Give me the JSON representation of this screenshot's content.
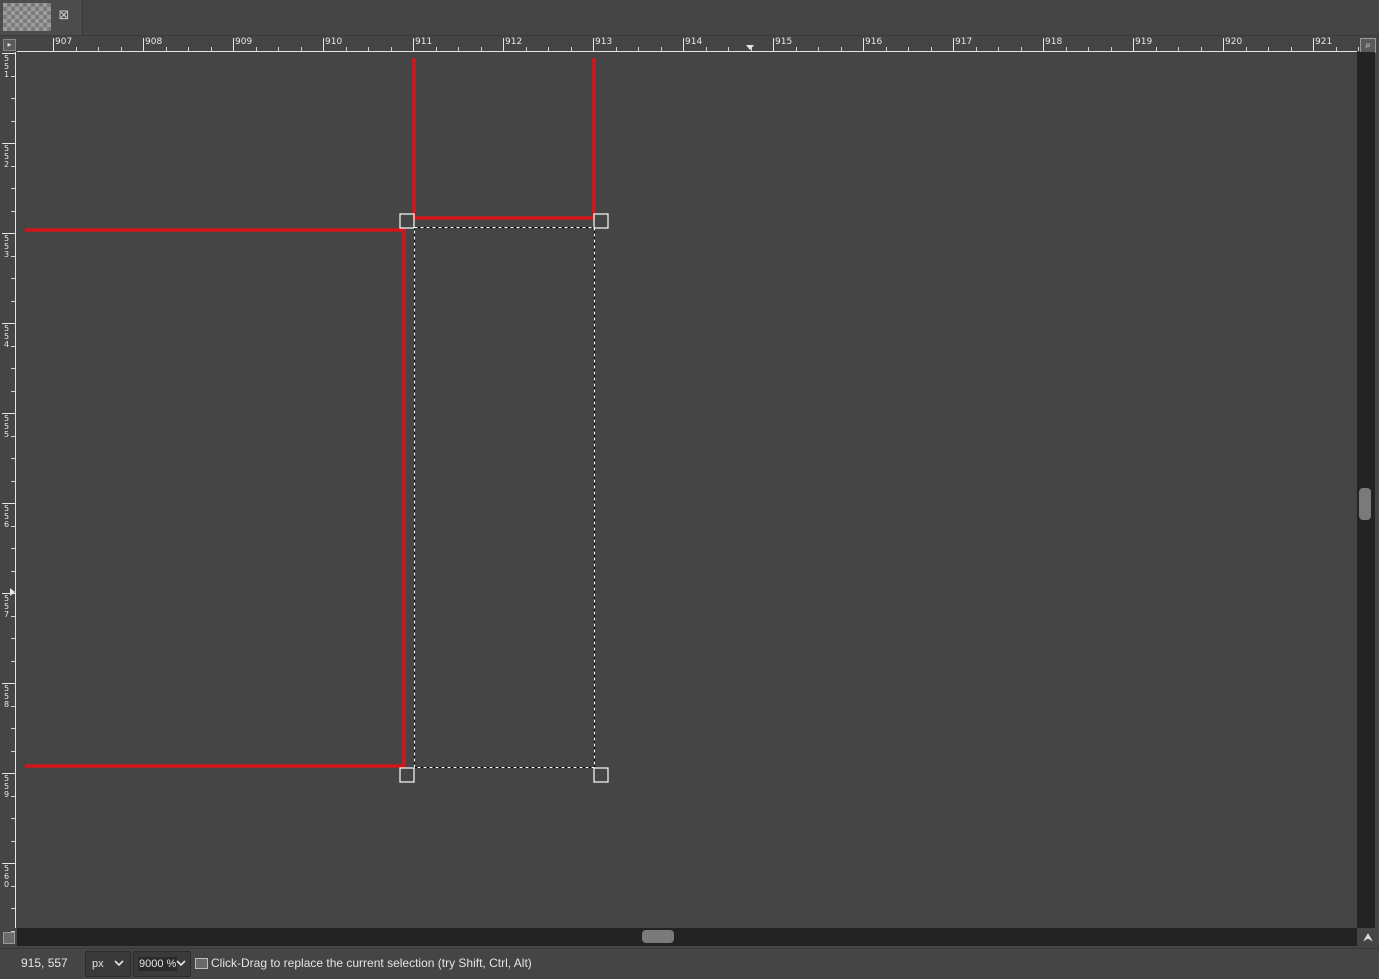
{
  "tab": {
    "close_glyph": "⊠",
    "thumbnail_icon": "checkerboard-thumbnail-icon",
    "close_icon": "close-tab-icon"
  },
  "rulers": {
    "horizontal_labels": [
      "907",
      "908",
      "909",
      "910",
      "911",
      "912",
      "913",
      "914",
      "915",
      "916",
      "917",
      "918",
      "919",
      "920",
      "921"
    ],
    "vertical_labels": [
      "551",
      "552",
      "553",
      "554",
      "555",
      "556",
      "557",
      "558",
      "559",
      "560"
    ]
  },
  "corner_icons": {
    "quickmask": "quick-mask-toggle-icon",
    "navigate": "navigate-magnifier-icon",
    "zoom_follow": "zoom-follow-arrow-icon"
  },
  "canvas": {
    "path_color": "#d0161c",
    "selection_color": "#ffffff",
    "handle_color": "#ffffff",
    "background": "#454545"
  },
  "statusbar": {
    "pointer_coords": "915, 557",
    "unit": "px",
    "zoom": "9000 %",
    "message": "Click-Drag to replace the current selection (try Shift, Ctrl, Alt)"
  }
}
